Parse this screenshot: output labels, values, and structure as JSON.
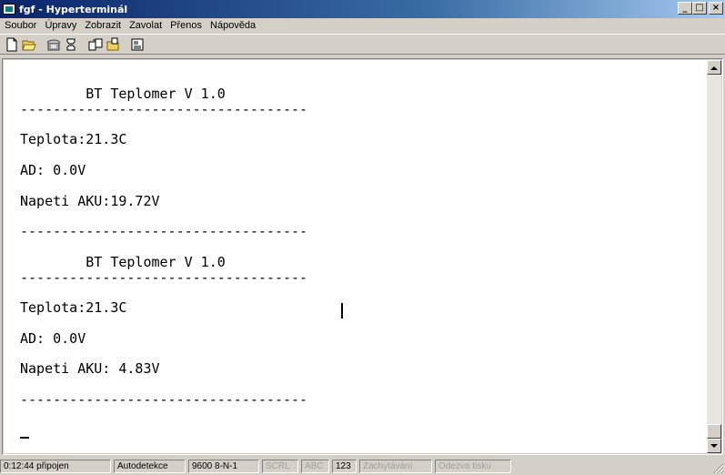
{
  "window": {
    "title": "fgf - Hyperterminál",
    "controls": {
      "minimize": "_",
      "maximize": "□",
      "close": "×"
    }
  },
  "menu": [
    "Soubor",
    "Úpravy",
    "Zobrazit",
    "Zavolat",
    "Přenos",
    "Nápověda"
  ],
  "toolbar": {
    "buttons": [
      "new-connection-icon",
      "open-icon",
      "call-icon",
      "disconnect-icon",
      "send-icon",
      "receive-icon",
      "properties-icon"
    ]
  },
  "terminal": {
    "text": "        BT Teplomer V 1.0\n-----------------------------------\n\nTeplota:21.3C\n\nAD: 0.0V\n\nNapeti AKU:19.72V\n\n-----------------------------------\n\n        BT Teplomer V 1.0\n-----------------------------------\n\nTeplota:21.3C\n\nAD: 0.0V\n\nNapeti AKU: 4.83V\n\n-----------------------------------"
  },
  "status": {
    "time": "0:12:44 připojen",
    "detect": "Autodetekce",
    "port": "9600 8-N-1",
    "scrl": "SCRL",
    "caps": "ABC",
    "num": "123",
    "capture": "Zachytávání",
    "print": "Odezva tisku"
  }
}
